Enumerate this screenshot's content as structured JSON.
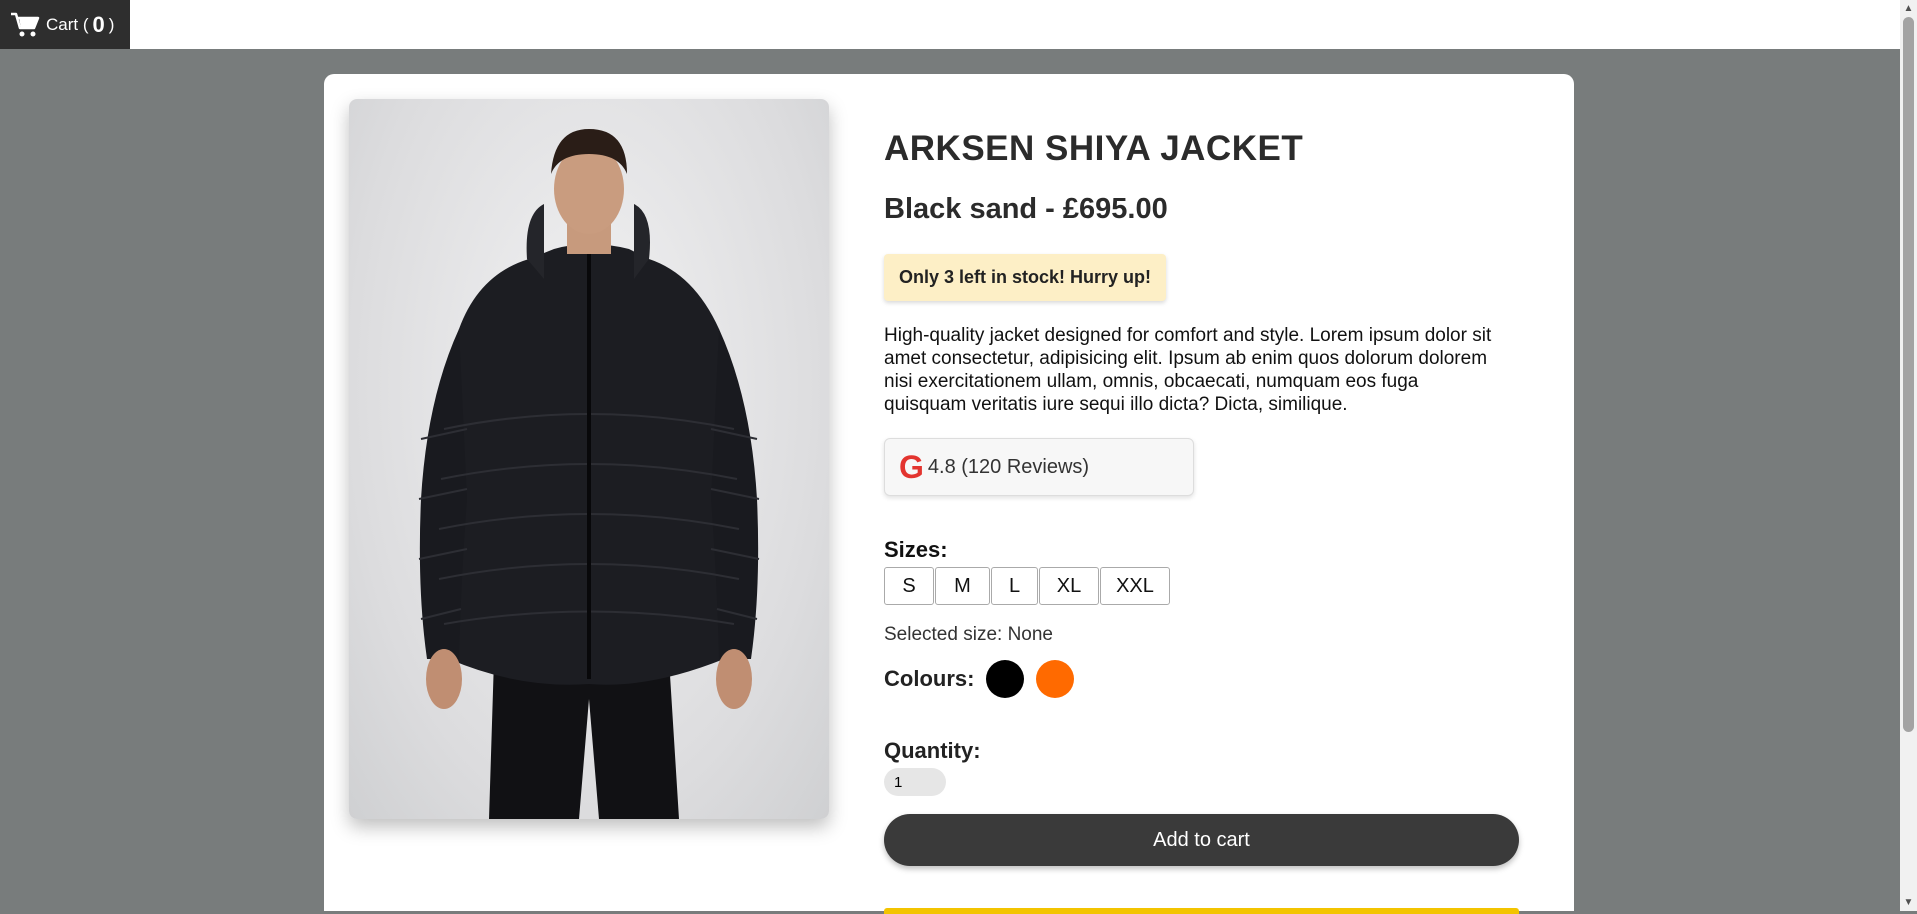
{
  "header": {
    "cart_label_pre": "Cart (",
    "cart_count": "0",
    "cart_label_post": ")"
  },
  "product": {
    "title": "ARKSEN SHIYA JACKET",
    "variant_price": "Black sand - £695.00",
    "stock_notice": "Only 3 left in stock! Hurry up!",
    "description": "High-quality jacket designed for comfort and style. Lorem ipsum dolor sit amet consectetur, adipisicing elit. Ipsum ab enim quos dolorum dolorem nisi exercitationem ullam, omnis, obcaecati, numquam eos fuga quisquam veritatis iure sequi illo dicta? Dicta, similique.",
    "rating": {
      "icon": "G",
      "text": "4.8 (120 Reviews)"
    },
    "sizes_label": "Sizes:",
    "sizes": [
      "S",
      "M",
      "L",
      "XL",
      "XXL"
    ],
    "selected_size_text": "Selected size: None",
    "colours_label": "Colours:",
    "colours": [
      {
        "name": "black",
        "hex": "#000000"
      },
      {
        "name": "orange",
        "hex": "#ff6a00"
      }
    ],
    "quantity_label": "Quantity:",
    "quantity_value": "1",
    "add_to_cart_label": "Add to cart"
  },
  "colors": {
    "page_bg": "#787c7c",
    "button_dark": "#3a3a3a",
    "stock_bg": "#fdefc6",
    "accent_yellow": "#f3c400"
  }
}
